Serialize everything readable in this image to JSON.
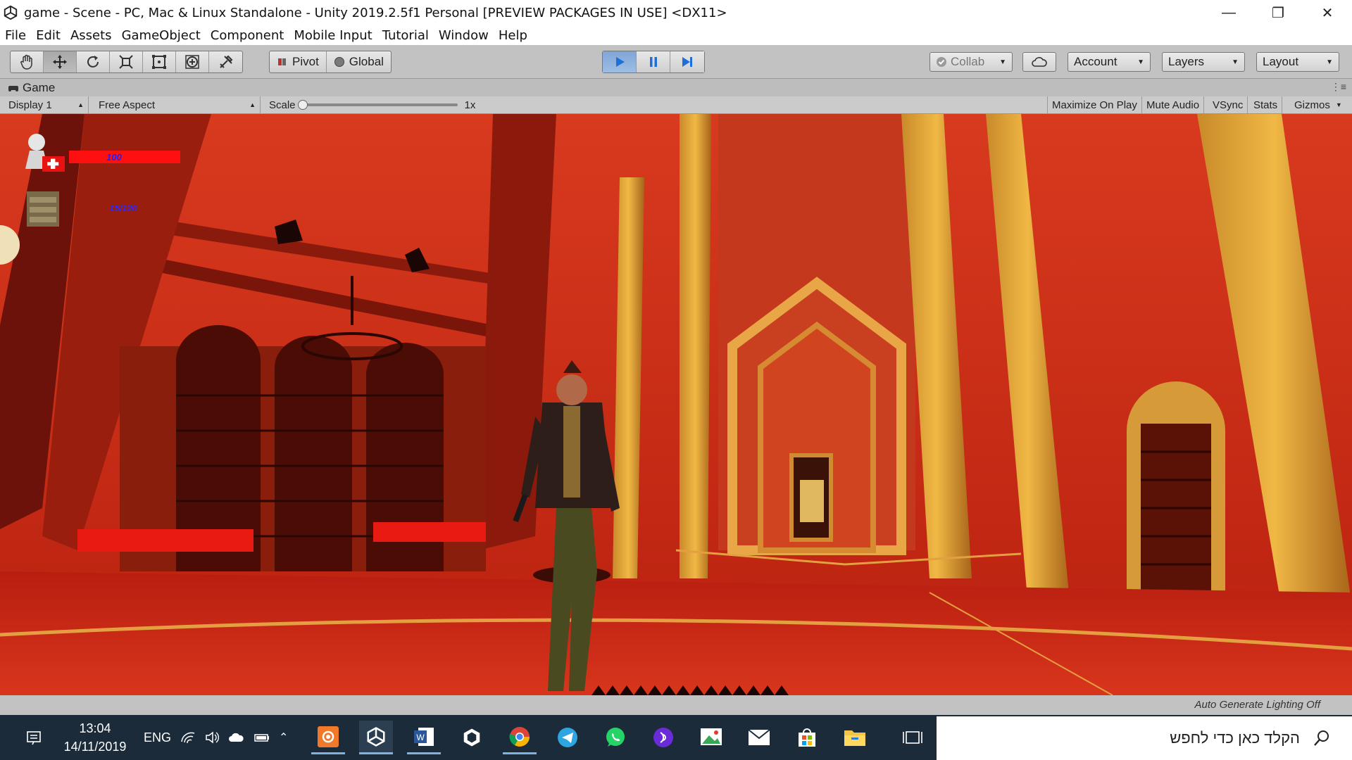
{
  "window": {
    "title": "game - Scene - PC, Mac & Linux Standalone - Unity 2019.2.5f1 Personal [PREVIEW PACKAGES IN USE] <DX11>"
  },
  "menu": [
    "File",
    "Edit",
    "Assets",
    "GameObject",
    "Component",
    "Mobile Input",
    "Tutorial",
    "Window",
    "Help"
  ],
  "toolbar": {
    "tools": [
      "hand-icon",
      "move-icon",
      "rotate-icon",
      "scale-icon",
      "rect-icon",
      "transform-icon",
      "custom-tool-icon"
    ],
    "pivot_label": "Pivot",
    "global_label": "Global",
    "collab_label": "Collab",
    "account_label": "Account",
    "layers_label": "Layers",
    "layout_label": "Layout"
  },
  "game_tab": {
    "tab_label": "Game",
    "display": "Display 1",
    "aspect": "Free Aspect",
    "scale_label": "Scale",
    "scale_value": "1x",
    "scale_level": 0,
    "buttons": [
      "Maximize On Play",
      "Mute Audio",
      "VSync",
      "Stats",
      "Gizmos"
    ]
  },
  "hud": {
    "health": "100",
    "ammo": "15/120"
  },
  "status": {
    "lighting": "Auto Generate Lighting Off"
  },
  "taskbar": {
    "time": "13:04",
    "date": "14/11/2019",
    "language": "ENG",
    "search_placeholder": "הקלד כאן כדי לחפש",
    "apps": [
      "screen-recorder-icon",
      "unity-icon",
      "word-icon",
      "unity-hub-icon",
      "chrome-icon",
      "telegram-icon",
      "whatsapp-icon",
      "podcast-icon",
      "photos-icon",
      "mail-icon",
      "store-icon",
      "file-explorer-icon",
      "task-view-icon"
    ]
  },
  "colors": {
    "play_active": "#7fa6d8",
    "scene_red": "#c8231a",
    "hud_bar": "#ff1010",
    "taskbar": "#1c2b3a"
  }
}
